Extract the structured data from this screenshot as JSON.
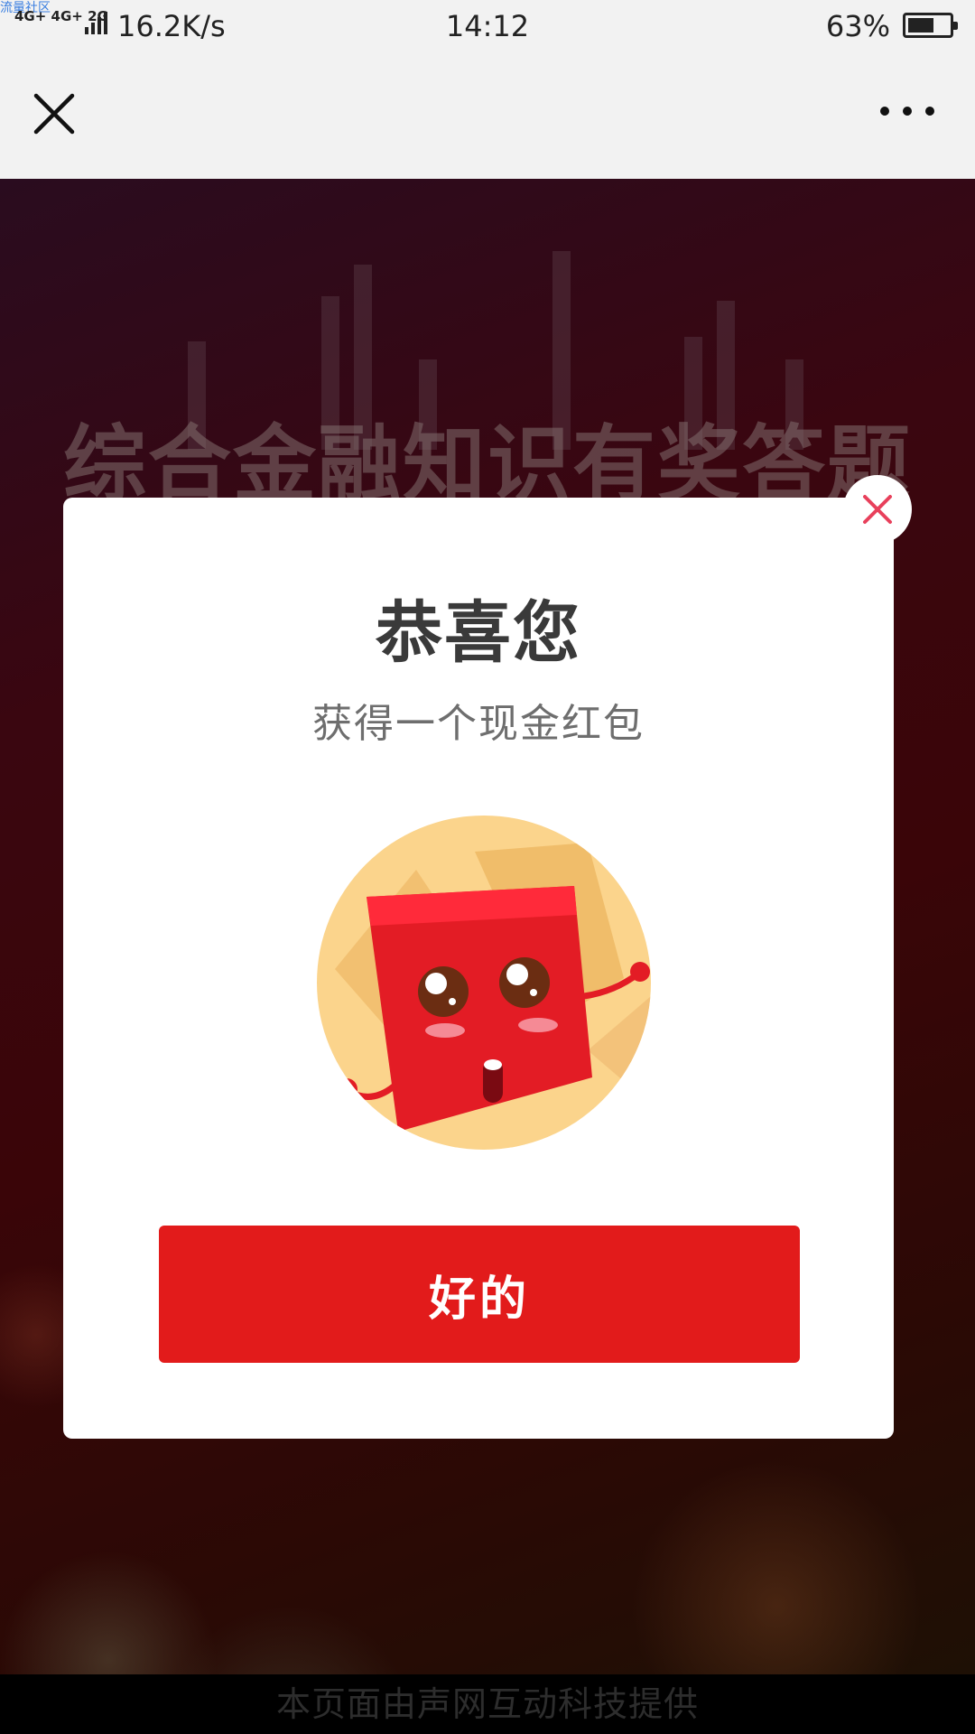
{
  "status_bar": {
    "watermark": "流量社区",
    "network_badges": "4G+ 4G+ 2G",
    "net_speed": "16.2K/s",
    "time": "14:12",
    "battery_percent": "63%",
    "battery_level": 0.63
  },
  "nav": {
    "close_icon": "close-icon",
    "more_icon": "more-icon"
  },
  "background": {
    "title": "综合金融知识有奖答题"
  },
  "modal": {
    "title": "恭喜您",
    "subtitle": "获得一个现金红包",
    "button_label": "好的",
    "close_icon": "close-icon",
    "image": "red-envelope-mascot"
  },
  "footer": {
    "text": "本页面由声网互动科技提供"
  },
  "colors": {
    "primary_red": "#e21b1b",
    "close_x": "#e8405b",
    "status_bg": "#f2f2f2"
  }
}
